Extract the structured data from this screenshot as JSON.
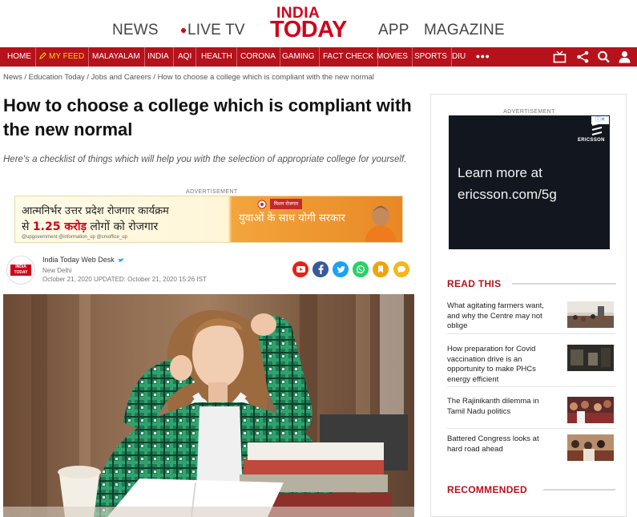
{
  "header": {
    "news": "NEWS",
    "live_tv": "LIVE TV",
    "logo_line1": "INDIA",
    "logo_line2": "TODAY",
    "app": "APP",
    "magazine": "MAGAZINE"
  },
  "navbar": {
    "items": [
      "HOME",
      "MY FEED",
      "MALAYALAM",
      "INDIA",
      "AQI",
      "HEALTH",
      "CORONA",
      "GAMING",
      "FACT CHECK",
      "MOVIES",
      "SPORTS",
      "DIU"
    ],
    "more": "•••",
    "icons": [
      "tv-icon",
      "share-icon",
      "search-icon",
      "user-icon"
    ]
  },
  "breadcrumb": {
    "text": "News / Education Today / Jobs and Careers / How to choose a college which is compliant with the new normal"
  },
  "article": {
    "headline": "How to choose a college which is compliant with the new normal",
    "summary": "Here's a checklist of things which will help you with the selection of appropriate college for yourself.",
    "ad_label": "ADVERTISEMENT",
    "ad": {
      "line1": "आत्मनिर्भर उत्तर प्रदेश रोजगार कार्यक्रम",
      "line2_pre": "से ",
      "line2_number": "1.25 करोड़",
      "line2_post": " लोगों को रोजगार",
      "right_text": "युवाओं के साथ योगी सरकार",
      "sub": "@upgovernment   @information_up   @cmoffice_up",
      "badge": "मिशन रोजगार"
    },
    "author_logo_text": "INDIA TODAY",
    "author": "India Today Web Desk",
    "location": "New Delhi",
    "date": "October 21, 2020 UPDATED: October 21, 2020 15:26 IST",
    "share_icons": [
      "youtube-icon",
      "facebook-icon",
      "twitter-icon",
      "whatsapp-icon",
      "bookmark-icon",
      "comment-icon"
    ],
    "share_colors": [
      "#e62117",
      "#3b5998",
      "#1da1f2",
      "#25d366",
      "#f0a30a",
      "#f3b71c"
    ]
  },
  "rail": {
    "ad_label": "ADVERTISEMENT",
    "ad_text_line1": "Learn more at",
    "ad_text_line2": "ericsson.com/5g",
    "ad_brand": "ERICSSON",
    "read_this_title": "READ THIS",
    "stories": [
      "What agitating farmers want, and why the Centre may not oblige",
      "How preparation for Covid vaccination drive is an opportunity to make PHCs energy efficient",
      "The Rajinikanth dilemma in Tamil Nadu politics",
      "Battered Congress looks at hard road ahead"
    ],
    "recommended_title": "RECOMMENDED"
  },
  "colors": {
    "brand_red": "#b5121b",
    "logo_red": "#d0021b",
    "feed_yellow": "#ffd200"
  }
}
